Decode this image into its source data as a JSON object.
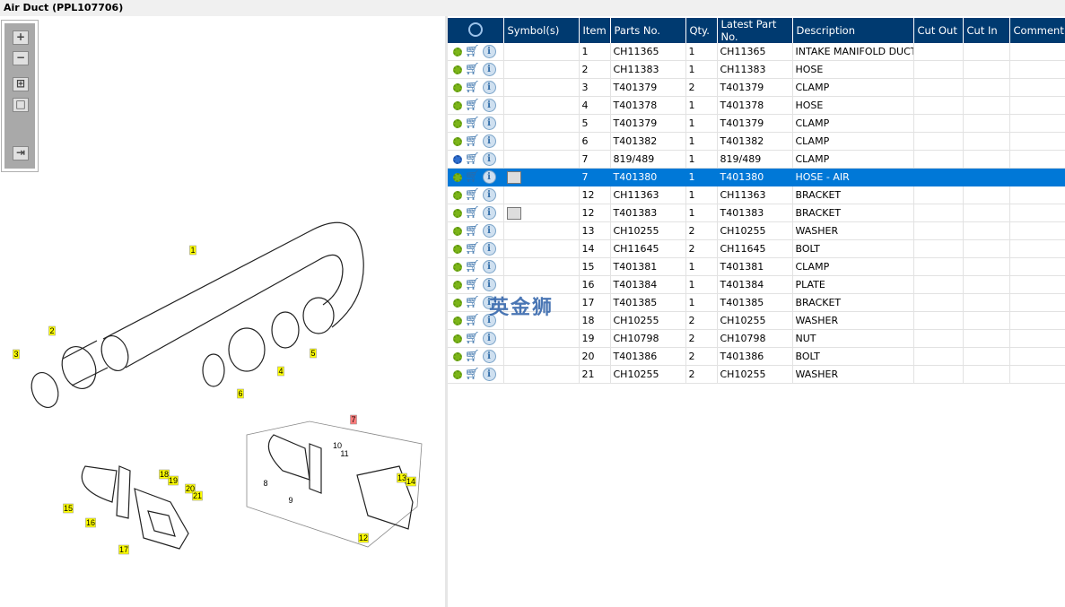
{
  "title": "Air Duct (PPL107706)",
  "toolbar": {
    "zoom_in": "+",
    "zoom_out": "−",
    "fit_all": "⊞",
    "fit_box": "□",
    "export": "⇥"
  },
  "diagram": {
    "callouts": [
      "1",
      "2",
      "3",
      "4",
      "5",
      "6",
      "7",
      "8",
      "9",
      "10",
      "11",
      "12",
      "13",
      "14",
      "15",
      "16",
      "17",
      "18",
      "19",
      "20",
      "21"
    ],
    "highlight_color": "#ffff00",
    "selected_color": "#ff7b7b"
  },
  "grid": {
    "columns": [
      "Symbol(s)",
      "Item",
      "Parts No.",
      "Qty.",
      "Latest Part No.",
      "Description",
      "Cut Out",
      "Cut In",
      "Comment"
    ],
    "rows": [
      {
        "item": "1",
        "part": "CH11365",
        "qty": "1",
        "latest": "CH11365",
        "desc": "INTAKE MANIFOLD DUCT",
        "sym": "",
        "multi": false
      },
      {
        "item": "2",
        "part": "CH11383",
        "qty": "1",
        "latest": "CH11383",
        "desc": "HOSE",
        "sym": "",
        "multi": false
      },
      {
        "item": "3",
        "part": "T401379",
        "qty": "2",
        "latest": "T401379",
        "desc": "CLAMP",
        "sym": "",
        "multi": false
      },
      {
        "item": "4",
        "part": "T401378",
        "qty": "1",
        "latest": "T401378",
        "desc": "HOSE",
        "sym": "",
        "multi": false
      },
      {
        "item": "5",
        "part": "T401379",
        "qty": "1",
        "latest": "T401379",
        "desc": "CLAMP",
        "sym": "",
        "multi": false
      },
      {
        "item": "6",
        "part": "T401382",
        "qty": "1",
        "latest": "T401382",
        "desc": "CLAMP",
        "sym": "",
        "multi": false
      },
      {
        "item": "7",
        "part": "819/489",
        "qty": "1",
        "latest": "819/489",
        "desc": "CLAMP",
        "sym": "",
        "multi": true
      },
      {
        "item": "7",
        "part": "T401380",
        "qty": "1",
        "latest": "T401380",
        "desc": "HOSE - AIR",
        "sym": "book",
        "multi": false,
        "selected": true
      },
      {
        "item": "12",
        "part": "CH11363",
        "qty": "1",
        "latest": "CH11363",
        "desc": "BRACKET",
        "sym": "",
        "multi": false
      },
      {
        "item": "12",
        "part": "T401383",
        "qty": "1",
        "latest": "T401383",
        "desc": "BRACKET",
        "sym": "book",
        "multi": false
      },
      {
        "item": "13",
        "part": "CH10255",
        "qty": "2",
        "latest": "CH10255",
        "desc": "WASHER",
        "sym": "",
        "multi": false
      },
      {
        "item": "14",
        "part": "CH11645",
        "qty": "2",
        "latest": "CH11645",
        "desc": "BOLT",
        "sym": "",
        "multi": false
      },
      {
        "item": "15",
        "part": "T401381",
        "qty": "1",
        "latest": "T401381",
        "desc": "CLAMP",
        "sym": "",
        "multi": false
      },
      {
        "item": "16",
        "part": "T401384",
        "qty": "1",
        "latest": "T401384",
        "desc": "PLATE",
        "sym": "",
        "multi": false
      },
      {
        "item": "17",
        "part": "T401385",
        "qty": "1",
        "latest": "T401385",
        "desc": "BRACKET",
        "sym": "",
        "multi": false
      },
      {
        "item": "18",
        "part": "CH10255",
        "qty": "2",
        "latest": "CH10255",
        "desc": "WASHER",
        "sym": "",
        "multi": false
      },
      {
        "item": "19",
        "part": "CH10798",
        "qty": "2",
        "latest": "CH10798",
        "desc": "NUT",
        "sym": "",
        "multi": false
      },
      {
        "item": "20",
        "part": "T401386",
        "qty": "2",
        "latest": "T401386",
        "desc": "BOLT",
        "sym": "",
        "multi": false
      },
      {
        "item": "21",
        "part": "CH10255",
        "qty": "2",
        "latest": "CH10255",
        "desc": "WASHER",
        "sym": "",
        "multi": false
      }
    ]
  },
  "watermark": "英金狮",
  "colors": {
    "header": "#003a70",
    "selected_row": "#0078d7"
  }
}
